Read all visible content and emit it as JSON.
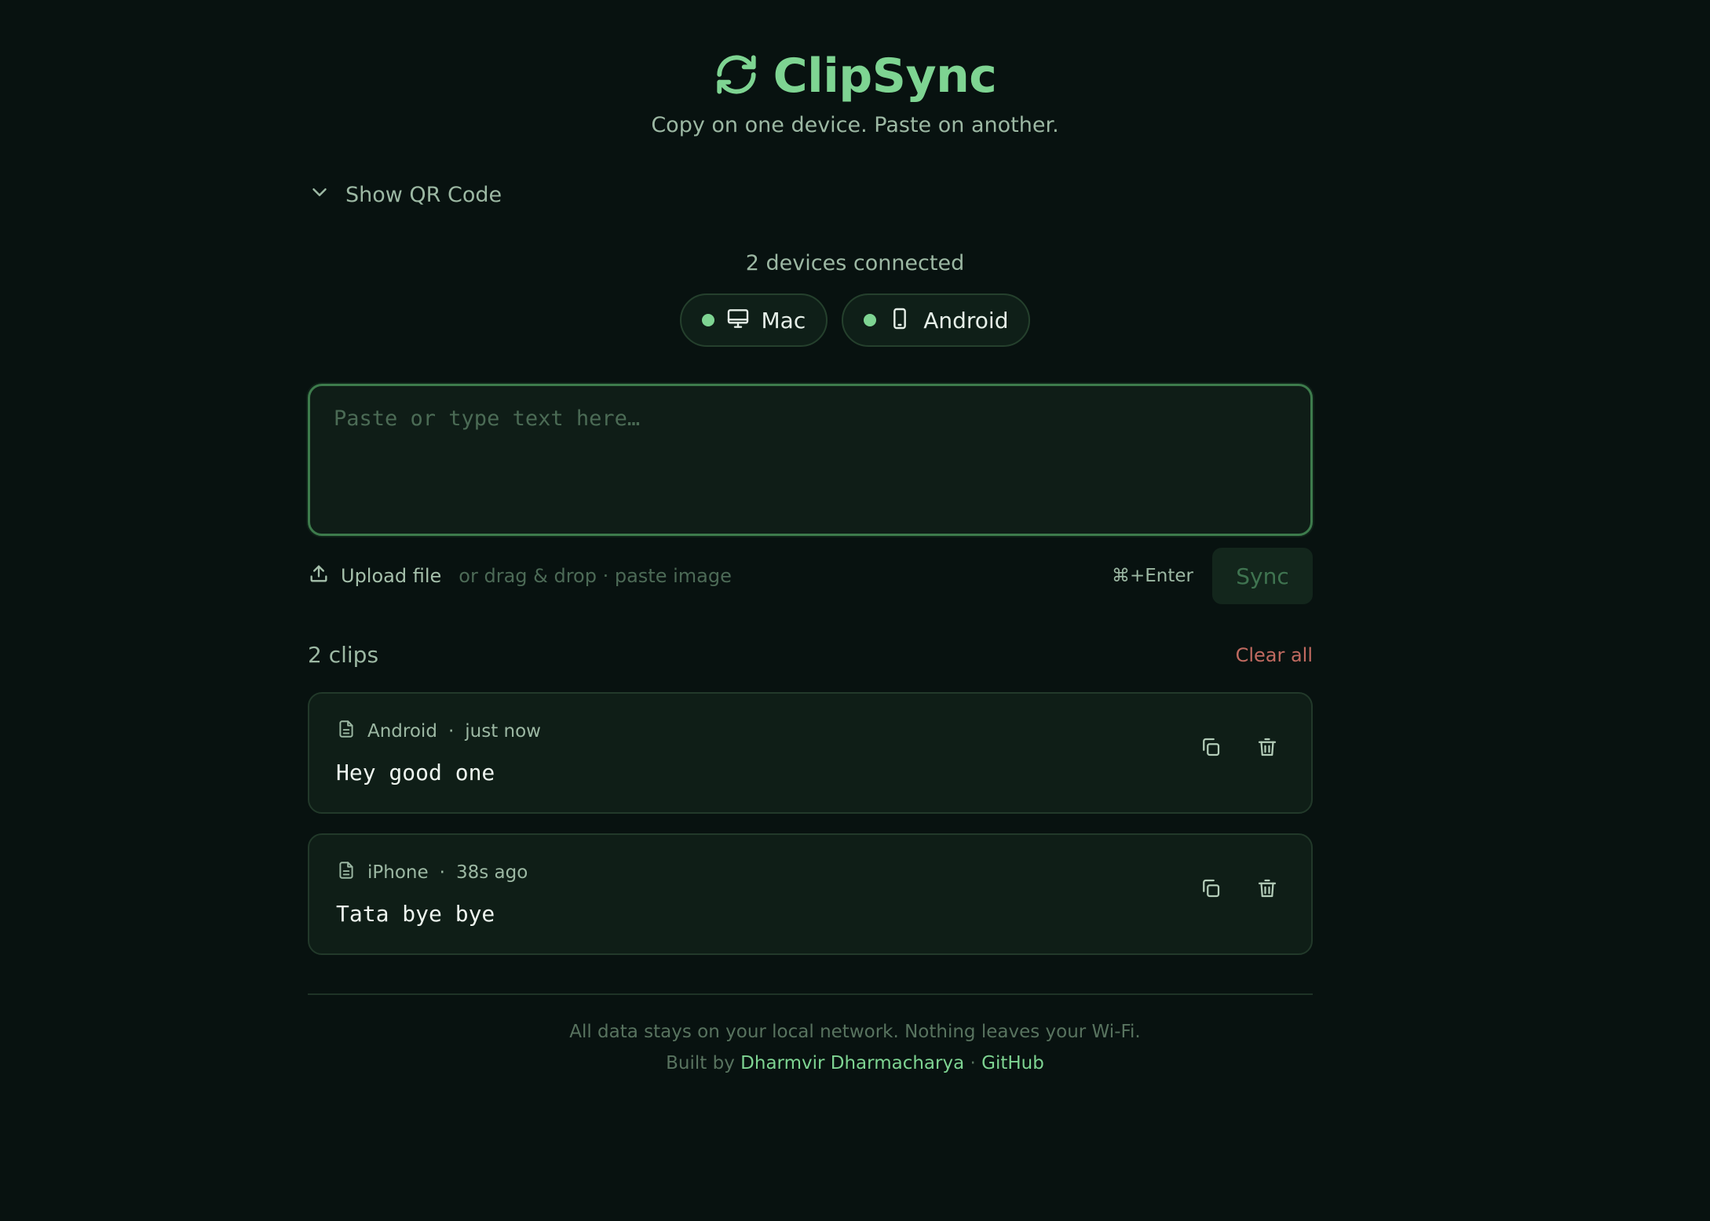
{
  "header": {
    "title": "ClipSync",
    "tagline": "Copy on one device. Paste on another.",
    "logo_icon": "sync-icon"
  },
  "qr_toggle": {
    "label": "Show QR Code",
    "icon": "chevron-down-icon"
  },
  "devices": {
    "count_label": "2 devices connected",
    "items": [
      {
        "name": "Mac",
        "icon": "monitor-icon",
        "status": "online"
      },
      {
        "name": "Android",
        "icon": "phone-icon",
        "status": "online"
      }
    ]
  },
  "input": {
    "placeholder": "Paste or type text here…",
    "value": ""
  },
  "actions": {
    "upload_label": "Upload file",
    "upload_hint": "or drag & drop · paste image",
    "shortcut": "⌘+Enter",
    "sync_label": "Sync"
  },
  "clips": {
    "count_label": "2 clips",
    "clear_all_label": "Clear all",
    "items": [
      {
        "device": "Android",
        "separator": "·",
        "time": "just now",
        "text": "Hey good one"
      },
      {
        "device": "iPhone",
        "separator": "·",
        "time": "38s ago",
        "text": "Tata bye bye"
      }
    ]
  },
  "footer": {
    "line1": "All data stays on your local network. Nothing leaves your Wi-Fi.",
    "built_by_prefix": "Built by",
    "author": "Dharmvir Dharmacharya",
    "separator": "·",
    "github": "GitHub"
  },
  "colors": {
    "background": "#081210",
    "accent": "#7ed492",
    "danger": "#c06a60",
    "muted": "#9cb8a3"
  }
}
